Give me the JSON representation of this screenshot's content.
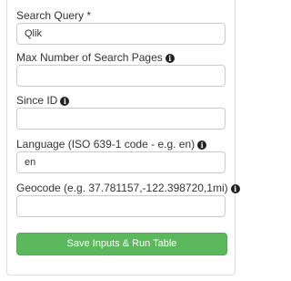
{
  "form": {
    "fields": [
      {
        "label": "Search Query *",
        "value": "Qlik",
        "placeholder": "",
        "info_icon": false
      },
      {
        "label": "Max Number of Search Pages",
        "value": "",
        "placeholder": "",
        "info_icon": true
      },
      {
        "label": "Since ID",
        "value": "",
        "placeholder": "",
        "info_icon": true
      },
      {
        "label": "Language (ISO 639-1 code - e.g. en)",
        "value": "en",
        "placeholder": "",
        "info_icon": true
      },
      {
        "label": "Geocode (e.g. 37.781157,-122.398720,1mi)",
        "value": "",
        "placeholder": "",
        "info_icon": true
      }
    ],
    "submit_label": "Save Inputs & Run Table"
  },
  "icons": {
    "info": "info-circle-icon"
  },
  "colors": {
    "button": "#5cb85c",
    "button_border": "#4cae4c",
    "input_border": "#cccccc"
  }
}
